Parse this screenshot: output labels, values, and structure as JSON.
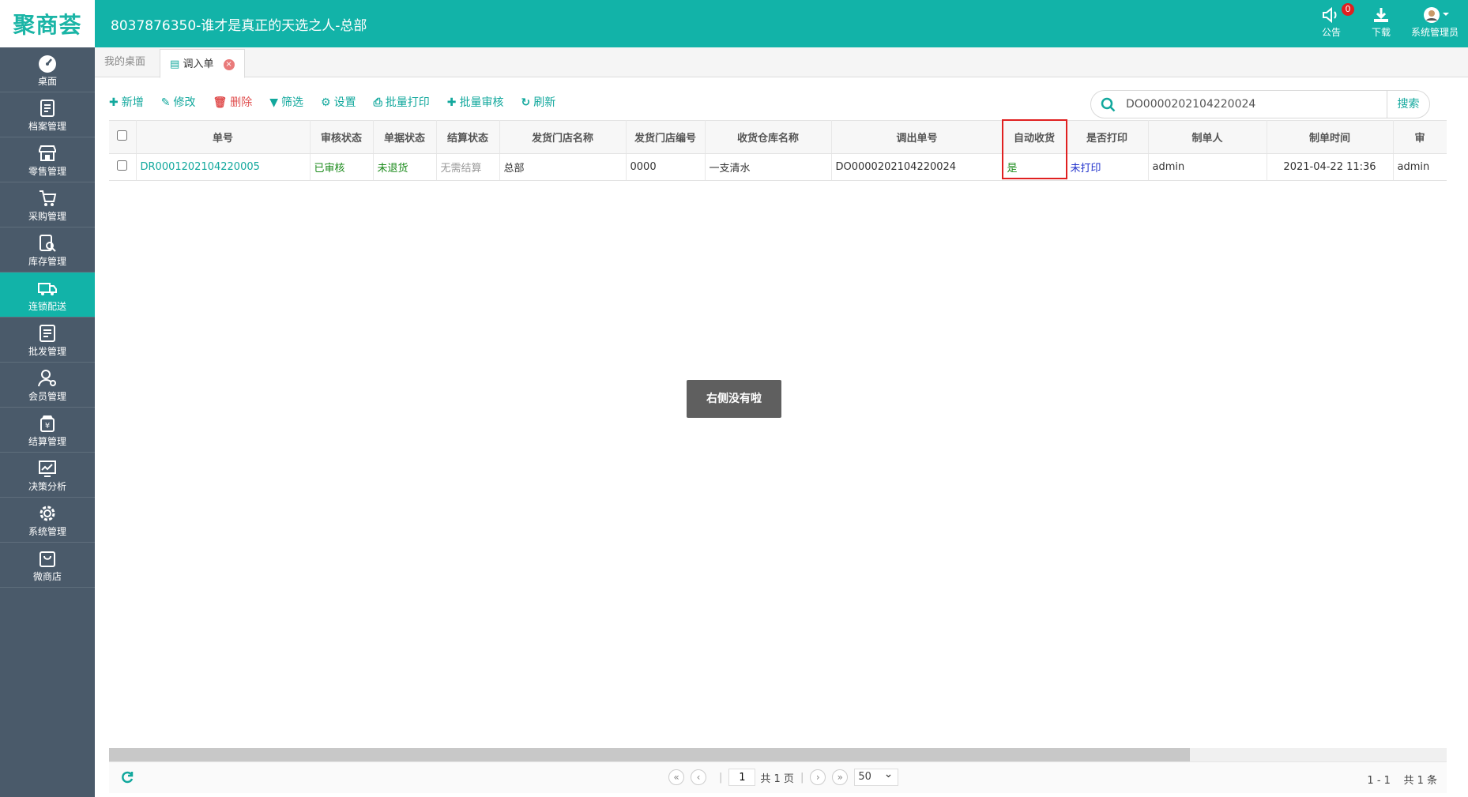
{
  "app": {
    "logo": "聚商荟",
    "title": "8037876350-谁才是真正的天选之人-总部",
    "notice_label": "公告",
    "notice_count": "0",
    "download_label": "下载",
    "user_label": "系统管理员"
  },
  "sidebar": {
    "items": [
      {
        "label": "桌面",
        "icon": "dashboard-icon"
      },
      {
        "label": "档案管理",
        "icon": "archive-icon"
      },
      {
        "label": "零售管理",
        "icon": "store-icon"
      },
      {
        "label": "采购管理",
        "icon": "cart-icon"
      },
      {
        "label": "库存管理",
        "icon": "inventory-icon"
      },
      {
        "label": "连锁配送",
        "icon": "truck-icon",
        "active": true
      },
      {
        "label": "批发管理",
        "icon": "wholesale-icon"
      },
      {
        "label": "会员管理",
        "icon": "member-icon"
      },
      {
        "label": "结算管理",
        "icon": "settlement-icon"
      },
      {
        "label": "决策分析",
        "icon": "chart-icon"
      },
      {
        "label": "系统管理",
        "icon": "gear-icon"
      },
      {
        "label": "微商店",
        "icon": "shop-bag-icon"
      }
    ]
  },
  "tabs": {
    "desktop": "我的桌面",
    "current": "调入单",
    "close": "×"
  },
  "toolbar": {
    "add": "新增",
    "edit": "修改",
    "delete": "删除",
    "filter": "筛选",
    "settings": "设置",
    "batch_print": "批量打印",
    "batch_audit": "批量审核",
    "refresh": "刷新"
  },
  "search": {
    "value": "DO0000202104220024",
    "button": "搜索"
  },
  "table": {
    "headers": {
      "order_no": "单号",
      "audit_status": "审核状态",
      "doc_status": "单据状态",
      "settle_status": "结算状态",
      "ship_store_name": "发货门店名称",
      "ship_store_no": "发货门店编号",
      "recv_wh_name": "收货仓库名称",
      "out_order_no": "调出单号",
      "auto_receive": "自动收货",
      "printed": "是否打印",
      "creator": "制单人",
      "created_at": "制单时间",
      "auditor": "审"
    },
    "rows": [
      {
        "order_no": "DR0001202104220005",
        "audit_status": "已审核",
        "doc_status": "未退货",
        "settle_status": "无需结算",
        "ship_store_name": "总部",
        "ship_store_no": "0000",
        "recv_wh_name": "一支清水",
        "out_order_no": "DO0000202104220024",
        "auto_receive": "是",
        "printed": "未打印",
        "creator": "admin",
        "created_at": "2021-04-22 11:36",
        "auditor": "admin"
      }
    ]
  },
  "toast": "右侧没有啦",
  "pager": {
    "first": "«",
    "prev": "‹",
    "page": "1",
    "total_pages": "共 1 页",
    "next": "›",
    "last": "»",
    "page_size": "50",
    "range": "1 - 1",
    "total": "共 1 条"
  },
  "colors": {
    "primary": "#12b3a8",
    "sidebar": "#4a5a6a",
    "highlight_box": "#e02020"
  }
}
